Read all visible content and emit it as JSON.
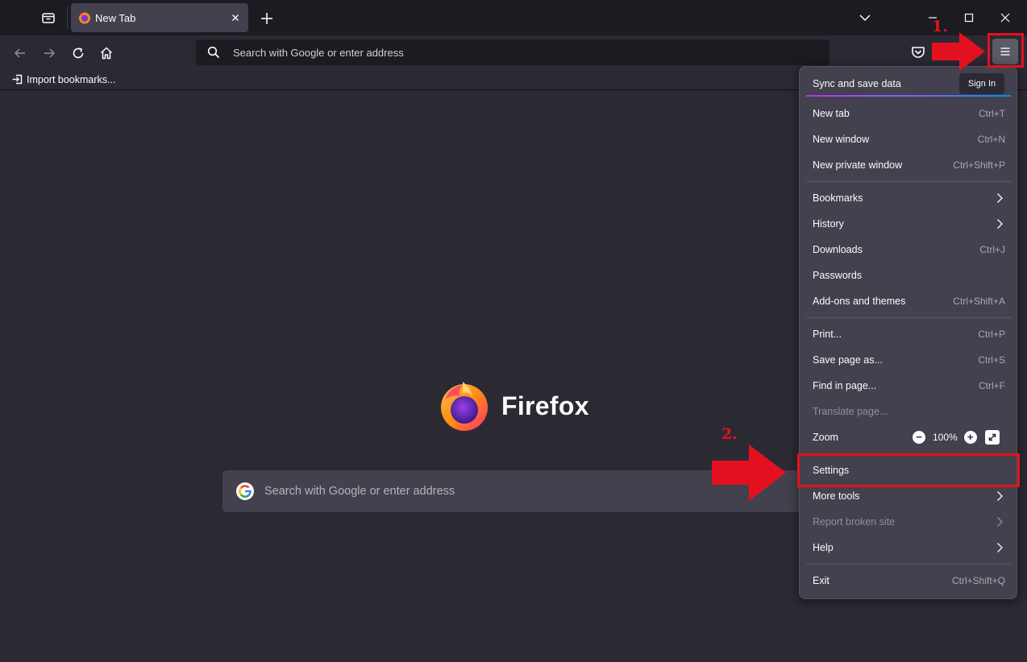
{
  "tab": {
    "title": "New Tab"
  },
  "urlbar": {
    "placeholder": "Search with Google or enter address"
  },
  "bookmarks_bar": {
    "import_label": "Import bookmarks..."
  },
  "content": {
    "brand": "Firefox",
    "search_placeholder": "Search with Google or enter address"
  },
  "app_menu": {
    "sync_label": "Sync and save data",
    "sign_in_label": "Sign In",
    "items": [
      {
        "label": "New tab",
        "shortcut": "Ctrl+T"
      },
      {
        "label": "New window",
        "shortcut": "Ctrl+N"
      },
      {
        "label": "New private window",
        "shortcut": "Ctrl+Shift+P"
      },
      {
        "label": "Bookmarks",
        "shortcut": ""
      },
      {
        "label": "History",
        "shortcut": ""
      },
      {
        "label": "Downloads",
        "shortcut": "Ctrl+J"
      },
      {
        "label": "Passwords",
        "shortcut": ""
      },
      {
        "label": "Add-ons and themes",
        "shortcut": "Ctrl+Shift+A"
      },
      {
        "label": "Print...",
        "shortcut": "Ctrl+P"
      },
      {
        "label": "Save page as...",
        "shortcut": "Ctrl+S"
      },
      {
        "label": "Find in page...",
        "shortcut": "Ctrl+F"
      },
      {
        "label": "Translate page...",
        "shortcut": ""
      },
      {
        "label": "Zoom",
        "shortcut": ""
      },
      {
        "label": "Settings",
        "shortcut": ""
      },
      {
        "label": "More tools",
        "shortcut": ""
      },
      {
        "label": "Report broken site",
        "shortcut": ""
      },
      {
        "label": "Help",
        "shortcut": ""
      },
      {
        "label": "Exit",
        "shortcut": "Ctrl+Shift+Q"
      }
    ],
    "zoom_value": "100%"
  },
  "annotations": {
    "step1": "1.",
    "step2": "2."
  },
  "colors": {
    "annotation_red": "#e3111f",
    "menu_bg": "#42414d",
    "page_bg": "#2b2a33"
  },
  "icons": [
    "tab-list-icon",
    "firefox-icon",
    "close-icon",
    "plus-icon",
    "chevron-down-icon",
    "minimize-icon",
    "maximize-icon",
    "back-arrow-icon",
    "forward-arrow-icon",
    "reload-icon",
    "home-icon",
    "search-icon",
    "pocket-icon",
    "hamburger-menu-icon",
    "import-icon",
    "google-icon",
    "chevron-right-icon",
    "fullscreen-icon"
  ]
}
